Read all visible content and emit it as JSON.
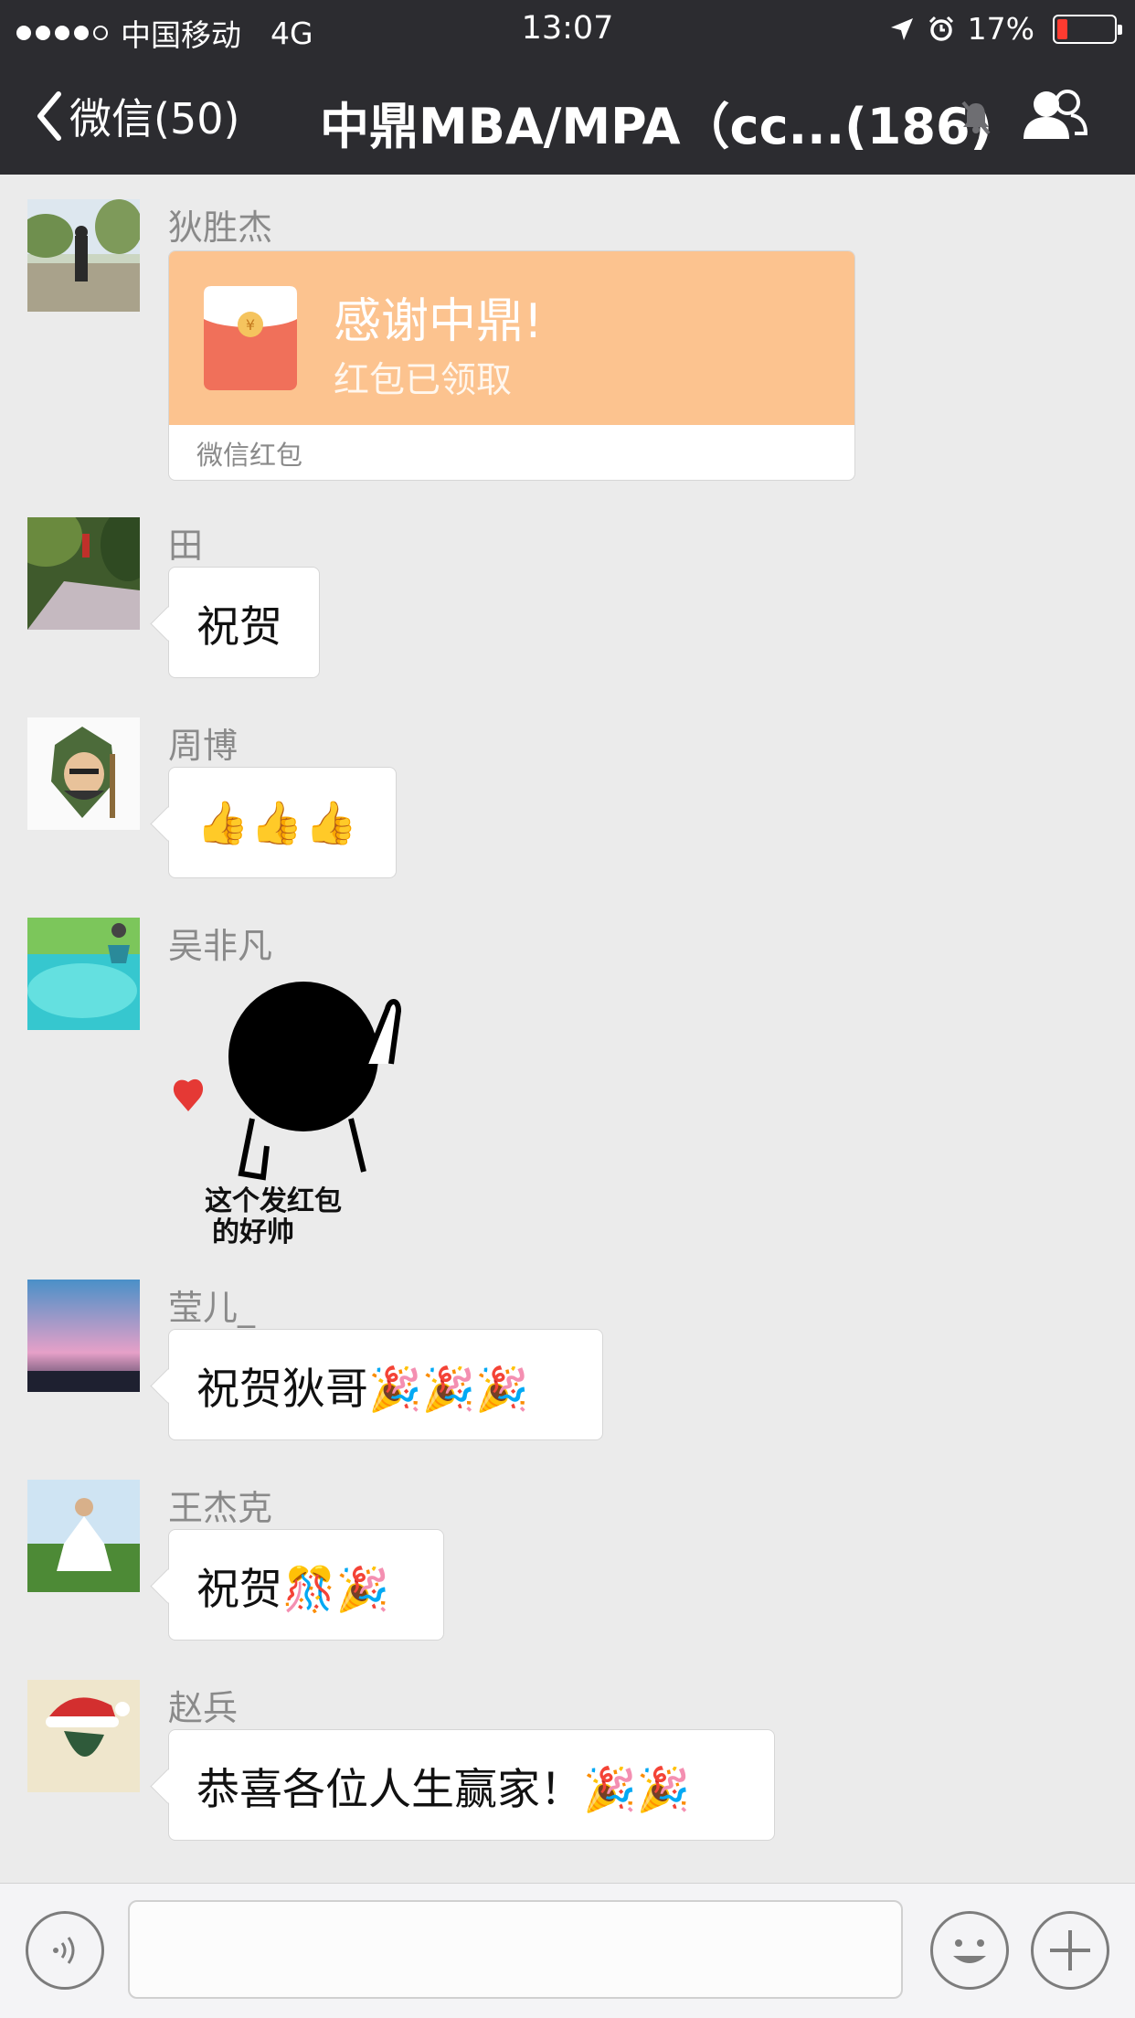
{
  "status_bar": {
    "carrier": "中国移动",
    "network": "4G",
    "time": "13:07",
    "battery_text": "17%",
    "battery_level": 0.17,
    "signal_bars": 4
  },
  "nav": {
    "back_label": "微信(50)",
    "title": "中鼎MBA/MPA（cc...(186)"
  },
  "colors": {
    "header_bg": "#2c2c30",
    "chat_bg": "#ebebeb",
    "red_packet": "#fcc38f"
  },
  "messages": [
    {
      "sender": "狄胜杰",
      "type": "red_packet",
      "title": "感谢中鼎!",
      "status": "红包已领取",
      "footer": "微信红包"
    },
    {
      "sender": "田",
      "type": "text",
      "text": "祝贺"
    },
    {
      "sender": "周博",
      "type": "emoji",
      "text": "👍👍👍"
    },
    {
      "sender": "吴非凡",
      "type": "sticker",
      "sticker_text": [
        "这个发红包",
        "的好帅"
      ]
    },
    {
      "sender": "莹儿_",
      "type": "text",
      "text": "祝贺狄哥🎉🎉🎉"
    },
    {
      "sender": "王杰克",
      "type": "text",
      "text": "祝贺🎊🎉"
    },
    {
      "sender": "赵兵",
      "type": "text",
      "text": "恭喜各位人生赢家！🎉🎉"
    }
  ],
  "input_bar": {
    "icons": [
      "voice-icon",
      "emoji-icon",
      "plus-icon"
    ]
  }
}
